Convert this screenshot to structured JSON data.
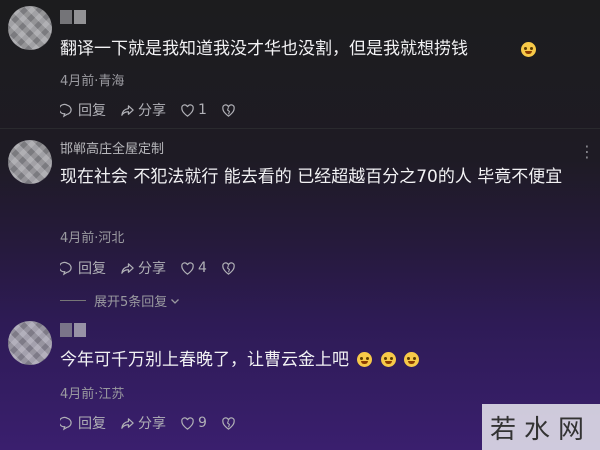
{
  "comments": [
    {
      "name": "",
      "text": "翻译一下就是我知道我没才华也没割，但是我就想捞钱",
      "meta": "4月前·青海",
      "reply_label": "回复",
      "share_label": "分享",
      "likes": "1"
    },
    {
      "name": "邯郸高庄全屋定制",
      "text": "现在社会 不犯法就行 能去看的 已经超越百分之70的人 毕竟不便宜",
      "meta": "4月前·河北",
      "reply_label": "回复",
      "share_label": "分享",
      "likes": "4",
      "expand_label": "展开5条回复"
    },
    {
      "name": "",
      "text": "今年可千万别上春晚了，让曹云金上吧",
      "meta": "4月前·江苏",
      "reply_label": "回复",
      "share_label": "分享",
      "likes": "9"
    }
  ],
  "watermark": "若水网",
  "icons": [
    "reply-icon",
    "share-icon",
    "like-icon",
    "dislike-icon",
    "more-icon",
    "chevron-down-icon"
  ]
}
